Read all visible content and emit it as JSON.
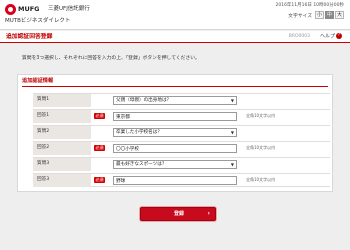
{
  "header": {
    "logo_text": "MUFG",
    "bank_name": "三菱UFJ信託銀行",
    "service_name": "MUTBビジネスダイレクト",
    "datetime": "2016年11月16日 10時00分00秒",
    "font_size_label": "文字サイズ",
    "font_size_options": [
      "小",
      "中",
      "大"
    ],
    "font_size_selected": "中",
    "brand_color": "#d8001c"
  },
  "title_bar": {
    "page_title": "追加認証回答登録",
    "screen_id": "BRO0003",
    "help_label": "ヘルプ"
  },
  "instruction": "質問を3つ選択し、それぞれに回答を入力の上、「登録」ボタンを押してください。",
  "section": {
    "title": "追加認証情報",
    "accent_color": "#cc0000"
  },
  "form": {
    "required_label": "必須",
    "rows": [
      {
        "label": "質問1",
        "type": "select",
        "value": "父親（母親）の出身地は？",
        "required": false
      },
      {
        "label": "回答1",
        "type": "text",
        "value": "東京都",
        "note": "全角10文字以内",
        "required": true
      },
      {
        "label": "質問2",
        "type": "select",
        "value": "卒業した小学校名は？",
        "required": false
      },
      {
        "label": "回答2",
        "type": "text",
        "value": "〇〇小学校",
        "note": "全角10文字以内",
        "required": true
      },
      {
        "label": "質問3",
        "type": "select",
        "value": "最も好きなスポーツは？",
        "required": false
      },
      {
        "label": "回答3",
        "type": "text",
        "value": "野球",
        "note": "全角10文字以内",
        "required": true
      }
    ]
  },
  "register_button": {
    "label": "登録",
    "color": "#c80a1e"
  }
}
